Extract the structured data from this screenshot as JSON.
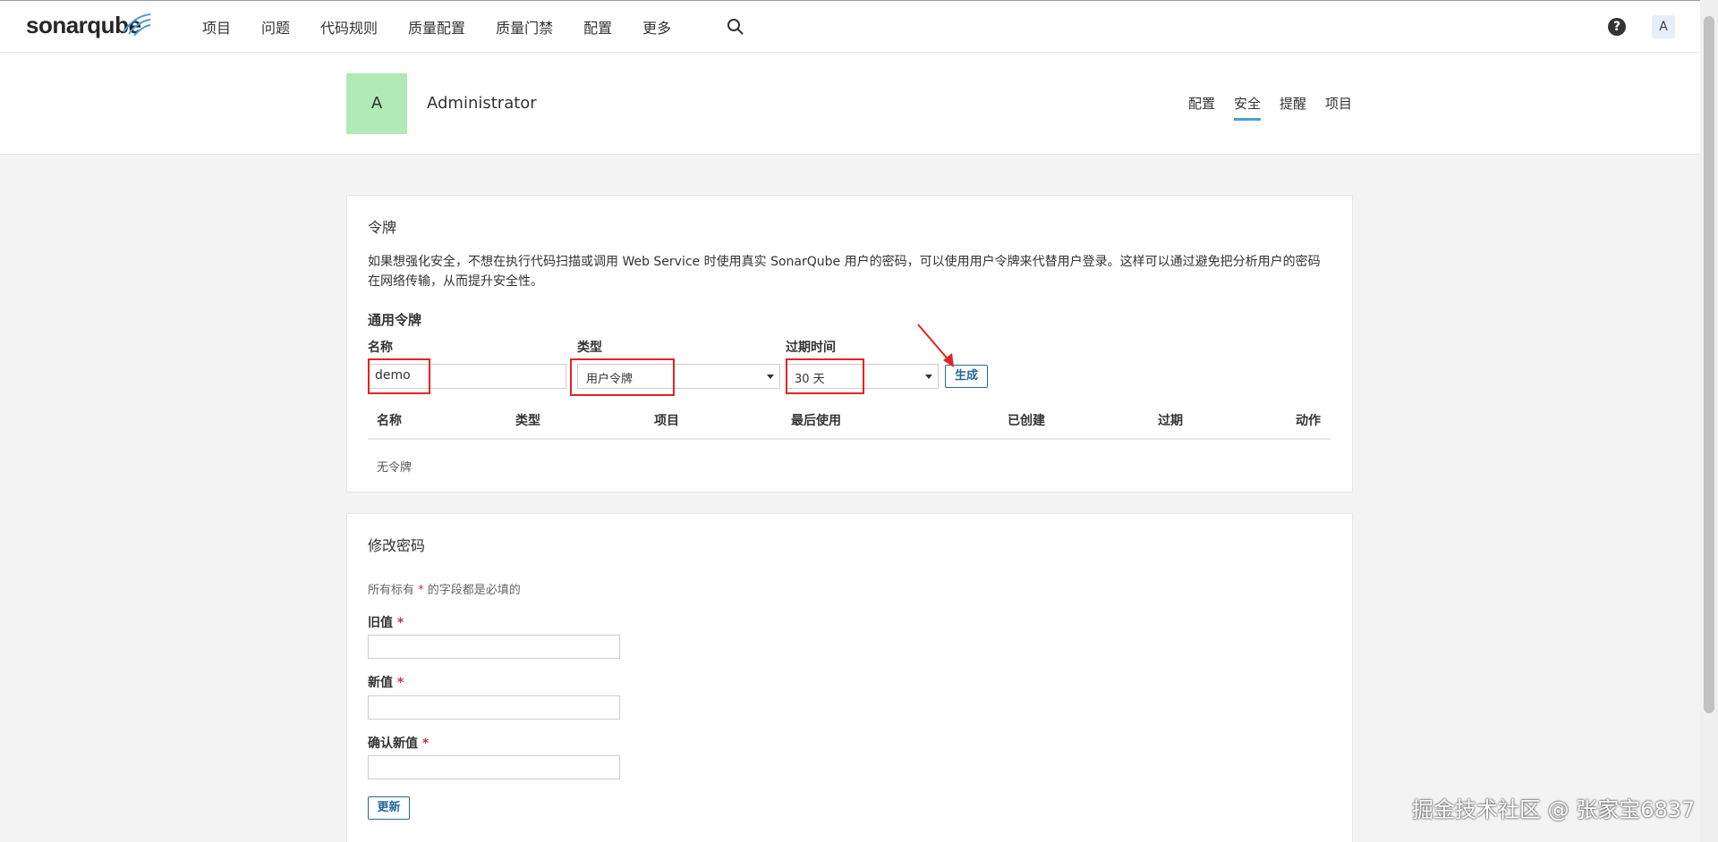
{
  "nav": {
    "logo": "sonarqube",
    "items": [
      "项目",
      "问题",
      "代码规则",
      "质量配置",
      "质量门禁",
      "配置",
      "更多"
    ],
    "help": "?",
    "user_initial": "A"
  },
  "account": {
    "avatar_initial": "A",
    "name": "Administrator",
    "tabs": [
      {
        "label": "配置",
        "active": false
      },
      {
        "label": "安全",
        "active": true
      },
      {
        "label": "提醒",
        "active": false
      },
      {
        "label": "项目",
        "active": false
      }
    ]
  },
  "tokens": {
    "title": "令牌",
    "description": "如果想强化安全，不想在执行代码扫描或调用 Web Service 时使用真实 SonarQube 用户的密码，可以使用用户令牌来代替用户登录。这样可以通过避免把分析用户的密码在网络传输，从而提升安全性。",
    "subheading": "通用令牌",
    "name_label": "名称",
    "name_value": "demo",
    "type_label": "类型",
    "type_value": "用户令牌",
    "expiry_label": "过期时间",
    "expiry_value": "30 天",
    "generate_label": "生成",
    "columns": [
      "名称",
      "类型",
      "项目",
      "最后使用",
      "已创建",
      "过期",
      "动作"
    ],
    "empty_text": "无令牌"
  },
  "password": {
    "title": "修改密码",
    "required_note_prefix": "所有标有",
    "required_star": "*",
    "required_note_suffix": "的字段都是必填的",
    "old_label": "旧值",
    "new_label": "新值",
    "confirm_label": "确认新值",
    "update_label": "更新"
  },
  "watermark": "掘金技术社区 @ 张家宝6837",
  "colors": {
    "accent": "#4b9fd5",
    "button": "#236a97",
    "highlight": "#e52222",
    "avatar_bg": "#b0eab6"
  }
}
